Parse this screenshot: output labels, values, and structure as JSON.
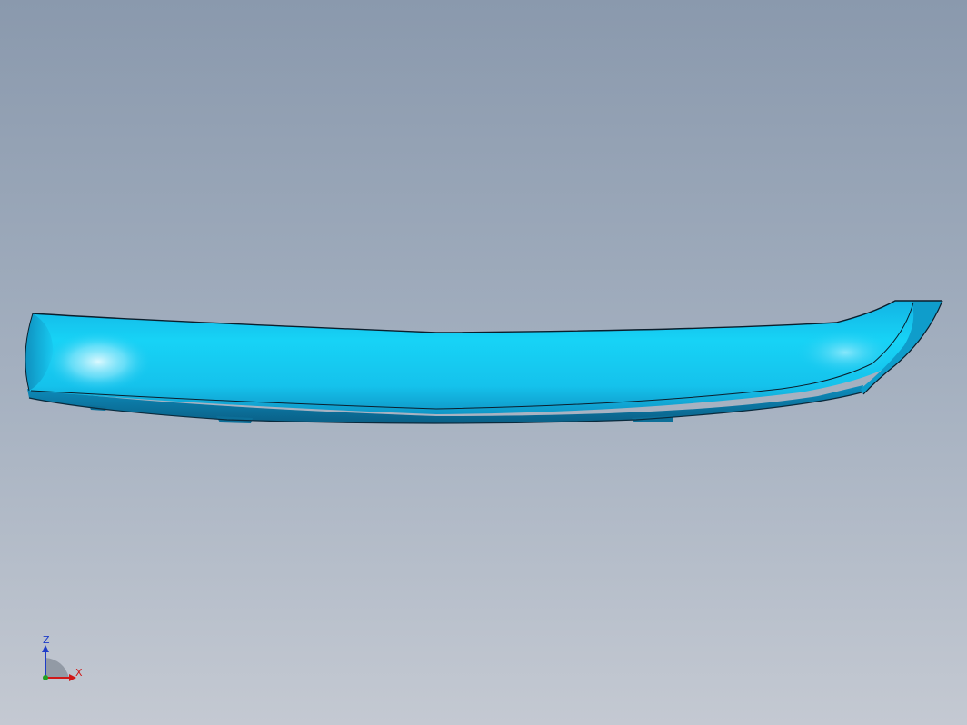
{
  "viewport": {
    "background_top": "#8a99ad",
    "background_bottom": "#c4c9d2"
  },
  "model": {
    "body_color": "#17c7ef",
    "highlight_color": "#bff4ff",
    "shadow_color": "#0b7fa8",
    "edge_color": "#0a1e2c"
  },
  "triad": {
    "z_label": "Z",
    "x_label": "X",
    "z_color": "#1e3cc8",
    "x_color": "#d01818",
    "y_color": "#20a020"
  }
}
